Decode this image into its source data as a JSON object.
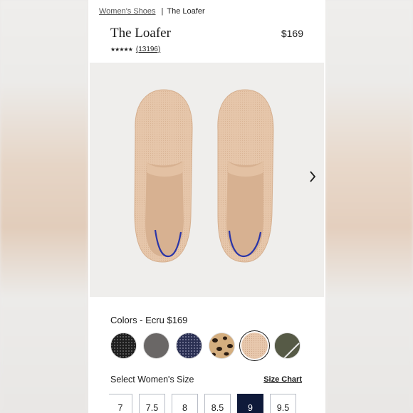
{
  "breadcrumb": {
    "parent": "Women's Shoes",
    "separator": "|",
    "current": "The Loafer"
  },
  "product": {
    "title": "The Loafer",
    "price": "$169",
    "stars": "★★★★★",
    "review_count": "(13196)"
  },
  "gallery": {
    "next_icon": "chevron-right-icon"
  },
  "colors": {
    "label": "Colors - Ecru $169",
    "swatches": [
      {
        "name": "black-knit",
        "color": "#262626"
      },
      {
        "name": "grey",
        "color": "#6a6766"
      },
      {
        "name": "navy-knit",
        "color": "#2f3558"
      },
      {
        "name": "leopard",
        "color": "#cfa878"
      },
      {
        "name": "ecru",
        "color": "#e7c7ac",
        "selected": true
      },
      {
        "name": "olive",
        "color": "#585b48"
      }
    ]
  },
  "size": {
    "label": "Select Women's Size",
    "chart_link": "Size Chart",
    "options": [
      "7",
      "7.5",
      "8",
      "8.5",
      "9",
      "9.5"
    ],
    "selected": "9"
  },
  "colors_theme": {
    "selected_size_bg": "#0f1a3a",
    "navy_trim": "#2a35a8"
  }
}
